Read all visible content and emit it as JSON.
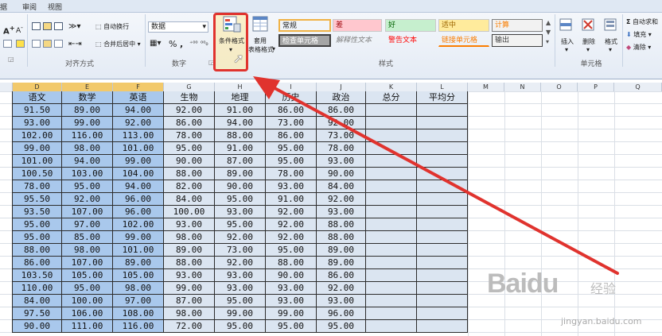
{
  "tabs": [
    "据",
    "审阅",
    "视图"
  ],
  "ribbon": {
    "alignment_group_label": "对齐方式",
    "number_group_label": "数字",
    "styles_group_label": "样式",
    "cells_group_label": "单元格",
    "wrap_text": "自动换行",
    "merge_center": "合并后居中",
    "number_format": "数据",
    "percent": "%",
    "comma": ",",
    "conditional_format": "条件格式",
    "format_as_table_1": "套用",
    "format_as_table_2": "表格格式",
    "insert": "插入",
    "delete": "删除",
    "format": "格式",
    "autosum": "自动求和",
    "fill": "填充",
    "clear": "清除",
    "styles": [
      {
        "label": "常规",
        "bg": "#ffffff",
        "fg": "#000000"
      },
      {
        "label": "差",
        "bg": "#ffc7ce",
        "fg": "#9c0006"
      },
      {
        "label": "好",
        "bg": "#c6efce",
        "fg": "#006100"
      },
      {
        "label": "适中",
        "bg": "#ffeb9c",
        "fg": "#9c6500"
      },
      {
        "label": "计算",
        "bg": "#f2f2f2",
        "fg": "#fa7d00"
      },
      {
        "label": "检查单元格",
        "bg": "#a5a5a5",
        "fg": "#ffffff"
      },
      {
        "label": "解释性文本",
        "bg": "#ffffff",
        "fg": "#7f7f7f"
      },
      {
        "label": "警告文本",
        "bg": "#ffffff",
        "fg": "#ff0000"
      },
      {
        "label": "链接单元格",
        "bg": "#ffffff",
        "fg": "#fa7d00"
      },
      {
        "label": "输出",
        "bg": "#f2f2f2",
        "fg": "#3f3f3f"
      }
    ]
  },
  "columns": [
    "D",
    "E",
    "F",
    "G",
    "H",
    "I",
    "J",
    "K",
    "L",
    "M",
    "N",
    "O",
    "P",
    "Q"
  ],
  "headers": [
    "语文",
    "数学",
    "英语",
    "生物",
    "地理",
    "历史",
    "政治",
    "总分",
    "平均分"
  ],
  "rows": [
    [
      "91.50",
      "89.00",
      "94.00",
      "92.00",
      "91.00",
      "86.00",
      "86.00"
    ],
    [
      "93.00",
      "99.00",
      "92.00",
      "86.00",
      "94.00",
      "73.00",
      "92.00"
    ],
    [
      "102.00",
      "116.00",
      "113.00",
      "78.00",
      "88.00",
      "86.00",
      "73.00"
    ],
    [
      "99.00",
      "98.00",
      "101.00",
      "95.00",
      "91.00",
      "95.00",
      "78.00"
    ],
    [
      "101.00",
      "94.00",
      "99.00",
      "90.00",
      "87.00",
      "95.00",
      "93.00"
    ],
    [
      "100.50",
      "103.00",
      "104.00",
      "88.00",
      "89.00",
      "78.00",
      "90.00"
    ],
    [
      "78.00",
      "95.00",
      "94.00",
      "82.00",
      "90.00",
      "93.00",
      "84.00"
    ],
    [
      "95.50",
      "92.00",
      "96.00",
      "84.00",
      "95.00",
      "91.00",
      "92.00"
    ],
    [
      "93.50",
      "107.00",
      "96.00",
      "100.00",
      "93.00",
      "92.00",
      "93.00"
    ],
    [
      "95.00",
      "97.00",
      "102.00",
      "93.00",
      "95.00",
      "92.00",
      "88.00"
    ],
    [
      "95.00",
      "85.00",
      "99.00",
      "98.00",
      "92.00",
      "92.00",
      "88.00"
    ],
    [
      "88.00",
      "98.00",
      "101.00",
      "89.00",
      "73.00",
      "95.00",
      "89.00"
    ],
    [
      "86.00",
      "107.00",
      "89.00",
      "88.00",
      "92.00",
      "88.00",
      "89.00"
    ],
    [
      "103.50",
      "105.00",
      "105.00",
      "93.00",
      "93.00",
      "90.00",
      "86.00"
    ],
    [
      "110.00",
      "95.00",
      "98.00",
      "99.00",
      "93.00",
      "93.00",
      "92.00"
    ],
    [
      "84.00",
      "100.00",
      "97.00",
      "87.00",
      "95.00",
      "93.00",
      "93.00"
    ],
    [
      "97.50",
      "106.00",
      "108.00",
      "98.00",
      "99.00",
      "99.00",
      "96.00"
    ],
    [
      "90.00",
      "111.00",
      "116.00",
      "72.00",
      "95.00",
      "95.00",
      "95.00"
    ]
  ],
  "watermark": {
    "brand": "Baidu",
    "suffix": "经验",
    "url": "jingyan.baidu.com"
  },
  "colors": {
    "selected_fill": "#a9c8ec",
    "table_fill": "#dbe5f1",
    "arrow": "#e0332e"
  }
}
